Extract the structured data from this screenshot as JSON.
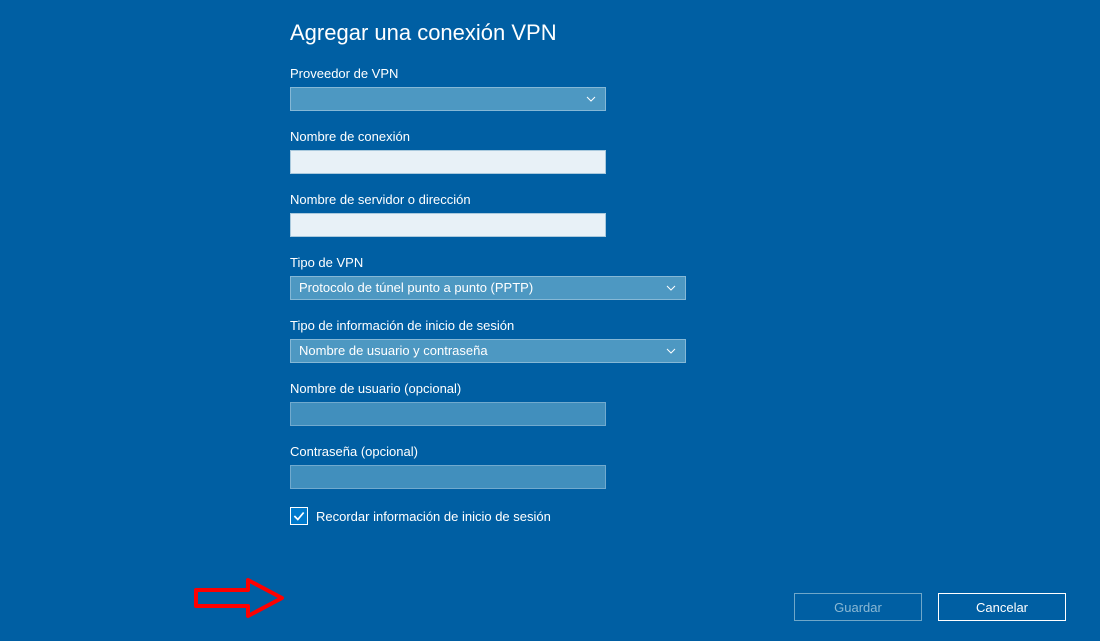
{
  "title": "Agregar una conexión VPN",
  "provider": {
    "label": "Proveedor de VPN",
    "value": ""
  },
  "connection_name": {
    "label": "Nombre de conexión",
    "value": ""
  },
  "server": {
    "label": "Nombre de servidor o dirección",
    "value": ""
  },
  "vpn_type": {
    "label": "Tipo de VPN",
    "value": "Protocolo de túnel punto a punto (PPTP)"
  },
  "signin_type": {
    "label": "Tipo de información de inicio de sesión",
    "value": "Nombre de usuario y contraseña"
  },
  "username": {
    "label": "Nombre de usuario (opcional)",
    "value": ""
  },
  "password": {
    "label": "Contraseña (opcional)",
    "value": ""
  },
  "remember": {
    "label": "Recordar información de inicio de sesión",
    "checked": true
  },
  "buttons": {
    "save": "Guardar",
    "cancel": "Cancelar"
  }
}
